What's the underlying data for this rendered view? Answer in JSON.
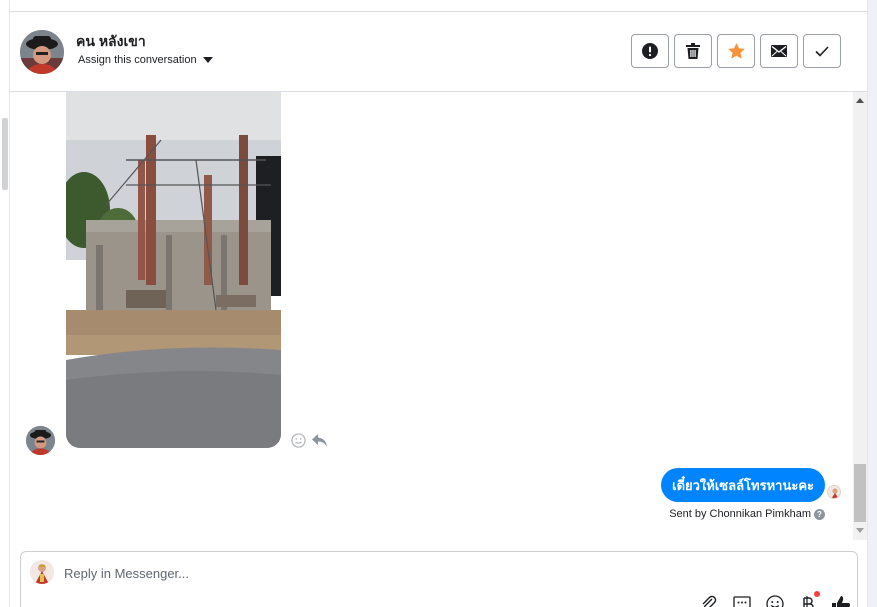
{
  "header": {
    "contact_name": "คน หลังเขา",
    "assign_label": "Assign this conversation",
    "actions": [
      {
        "name": "mark-spam-button",
        "icon": "exclamation-circle-icon"
      },
      {
        "name": "delete-button",
        "icon": "trash-icon"
      },
      {
        "name": "star-button",
        "icon": "star-icon"
      },
      {
        "name": "mark-unread-button",
        "icon": "envelope-icon"
      },
      {
        "name": "mark-done-button",
        "icon": "checkmark-icon"
      }
    ]
  },
  "thread": {
    "incoming_photo": {
      "kind": "image",
      "subject": "construction site"
    },
    "message_tools": [
      "smiley-icon",
      "reply-arrow-icon"
    ],
    "outgoing_message": "เดี๋ยวให้เซลล์โทรหานะคะ",
    "sent_by_prefix": "Sent by",
    "sent_by_name": "Chonnikan Pimkham"
  },
  "composer": {
    "placeholder": "Reply in Messenger...",
    "tools": [
      "paperclip-icon",
      "saved-reply-icon",
      "emoji-icon",
      "baht-payment-icon",
      "thumbs-up-icon"
    ]
  },
  "colors": {
    "accent": "#0084ff",
    "star": "#f7923b",
    "border": "#dadde1",
    "notification": "#fa3e3e"
  }
}
